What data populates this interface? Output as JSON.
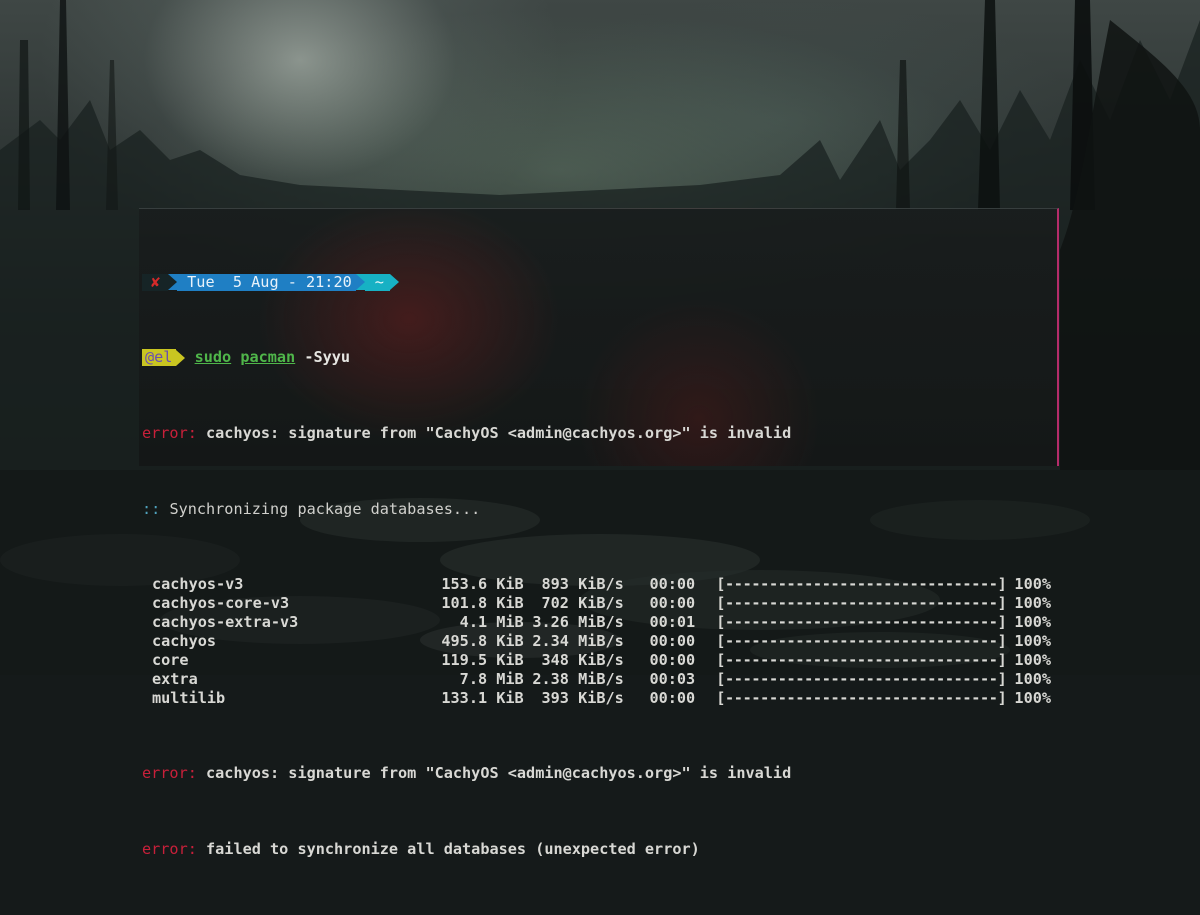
{
  "prompt": {
    "status_icon": "x-mark-icon",
    "datetime": "Tue  5 Aug - 21:20",
    "directory": "~",
    "user": "@el",
    "command": {
      "sudo": "sudo",
      "program": "pacman",
      "args": " -Syyu"
    }
  },
  "output": {
    "error_label": "error:",
    "sync_prefix": "::",
    "error_1": " cachyos: signature from \"CachyOS <admin@cachyos.org>\" is invalid",
    "sync_message": " Synchronizing package databases...",
    "packages": [
      {
        "name": "cachyos-v3",
        "size": "153.6 KiB",
        "rate": "893 KiB/s",
        "time": "00:00",
        "bar": "[-------------------------------]",
        "percent": "100%"
      },
      {
        "name": "cachyos-core-v3",
        "size": "101.8 KiB",
        "rate": "702 KiB/s",
        "time": "00:00",
        "bar": "[-------------------------------]",
        "percent": "100%"
      },
      {
        "name": "cachyos-extra-v3",
        "size": "4.1 MiB",
        "rate": "3.26 MiB/s",
        "time": "00:01",
        "bar": "[-------------------------------]",
        "percent": "100%"
      },
      {
        "name": "cachyos",
        "size": "495.8 KiB",
        "rate": "2.34 MiB/s",
        "time": "00:00",
        "bar": "[-------------------------------]",
        "percent": "100%"
      },
      {
        "name": "core",
        "size": "119.5 KiB",
        "rate": "348 KiB/s",
        "time": "00:00",
        "bar": "[-------------------------------]",
        "percent": "100%"
      },
      {
        "name": "extra",
        "size": "7.8 MiB",
        "rate": "2.38 MiB/s",
        "time": "00:03",
        "bar": "[-------------------------------]",
        "percent": "100%"
      },
      {
        "name": "multilib",
        "size": "133.1 KiB",
        "rate": "393 KiB/s",
        "time": "00:00",
        "bar": "[-------------------------------]",
        "percent": "100%"
      }
    ],
    "error_2": " cachyos: signature from \"CachyOS <admin@cachyos.org>\" is invalid",
    "error_3": " failed to synchronize all databases (unexpected error)"
  },
  "colors": {
    "error": "#c8203a",
    "sync": "#4fa3bd",
    "command": "#4fb64a",
    "date_segment": "#1f7fc4",
    "dir_segment": "#17b1c4",
    "user_segment": "#c9c521",
    "window_border": "#b52c6a"
  }
}
